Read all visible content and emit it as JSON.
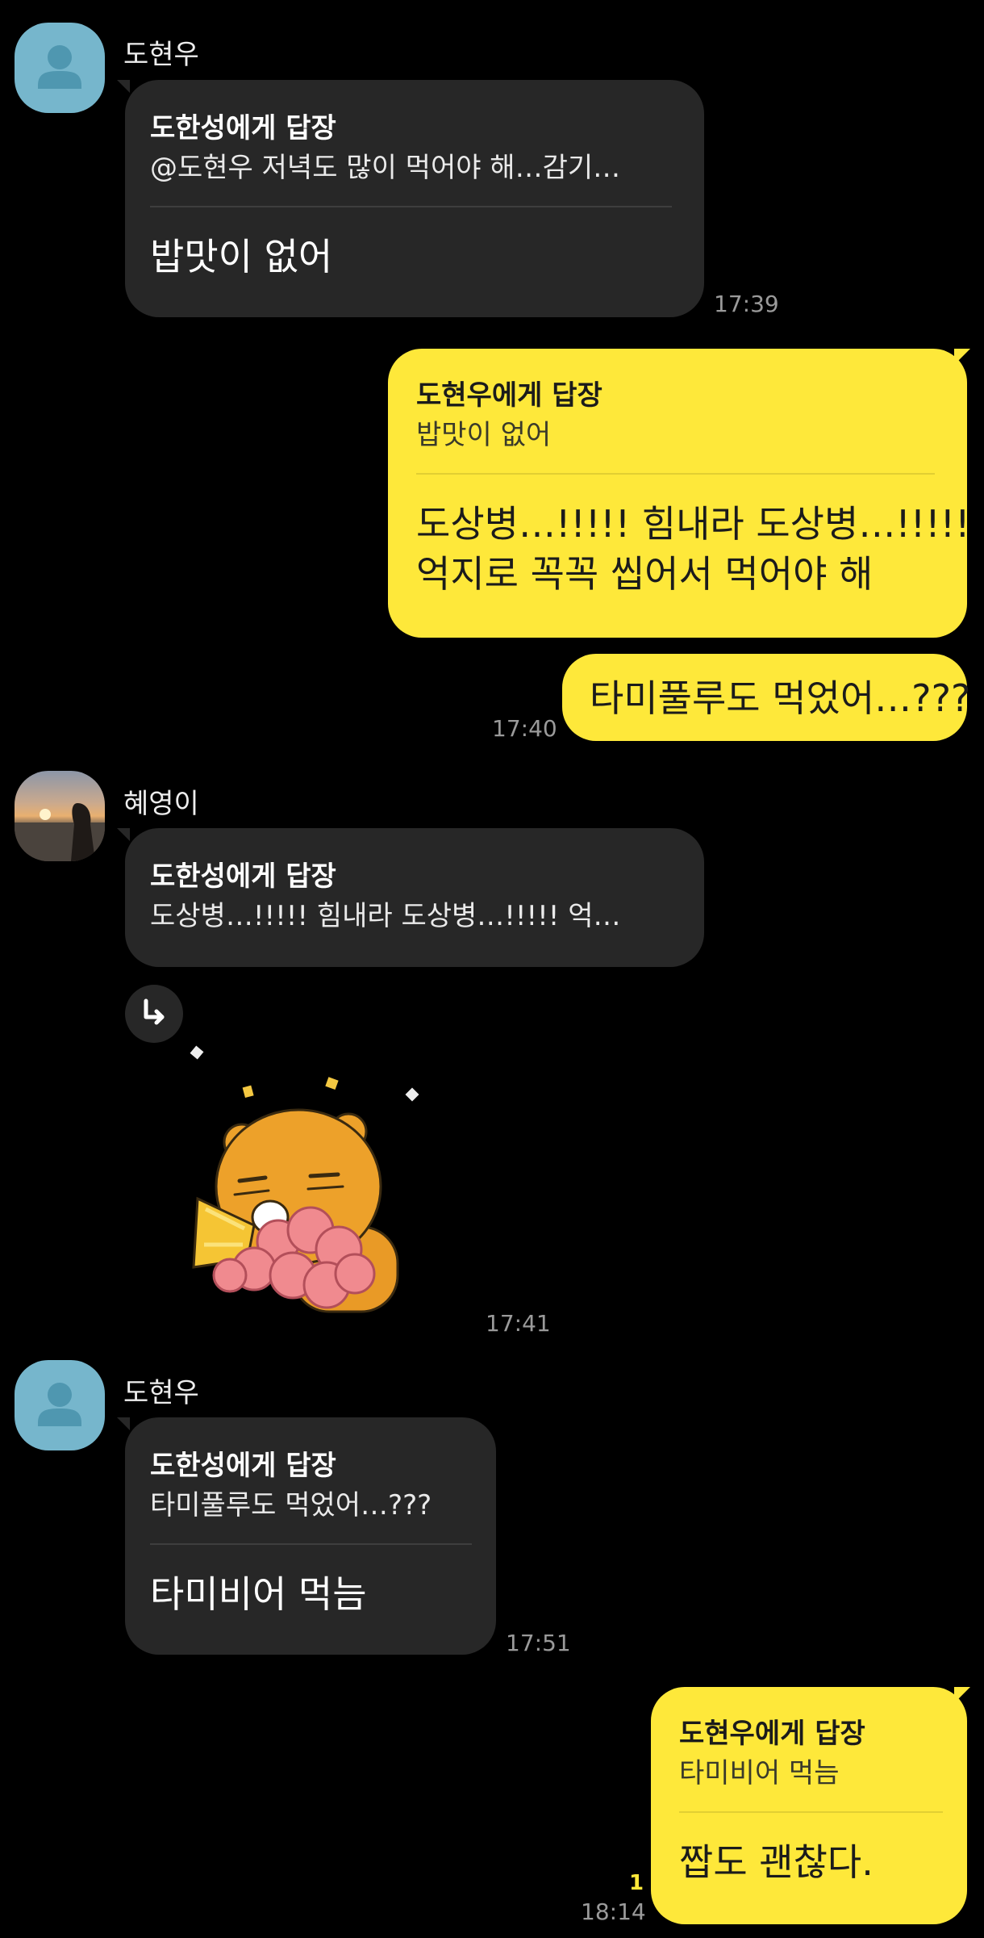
{
  "messages": [
    {
      "sender": "도현우",
      "reply_title": "도한성에게 답장",
      "reply_preview": "@도현우 저녁도 많이 먹어야 해…감기…",
      "text": "밥맛이 없어",
      "time": "17:39"
    },
    {
      "reply_title": "도현우에게 답장",
      "reply_preview": "밥맛이 없어",
      "text_line1": "도상병…!!!!! 힘내라 도상병…!!!!!",
      "text_line2": "억지로 꼭꼭 씹어서 먹어야 해"
    },
    {
      "text": "타미풀루도 먹었어…???",
      "time": "17:40"
    },
    {
      "sender": "혜영이",
      "reply_title": "도한성에게 답장",
      "reply_preview": "도상병…!!!!! 힘내라 도상병…!!!!! 억…",
      "time": "17:41"
    },
    {
      "sender": "도현우",
      "reply_title": "도한성에게 답장",
      "reply_preview": "타미풀루도 먹었어…???",
      "text": "타미비어 먹늠",
      "time": "17:51"
    },
    {
      "reply_title": "도현우에게 답장",
      "reply_preview": "타미비어 먹늠",
      "text": "짭도 괜찮다.",
      "time": "18:14",
      "unread": "1"
    }
  ],
  "colors": {
    "background": "#000000",
    "incoming_bubble": "#272727",
    "outgoing_bubble": "#fee83a",
    "default_avatar": "#76b6cc"
  },
  "icons": {
    "default_avatar": "person-icon",
    "forward": "reply-arrow-icon",
    "sticker": "ryan-bear-sticker"
  }
}
